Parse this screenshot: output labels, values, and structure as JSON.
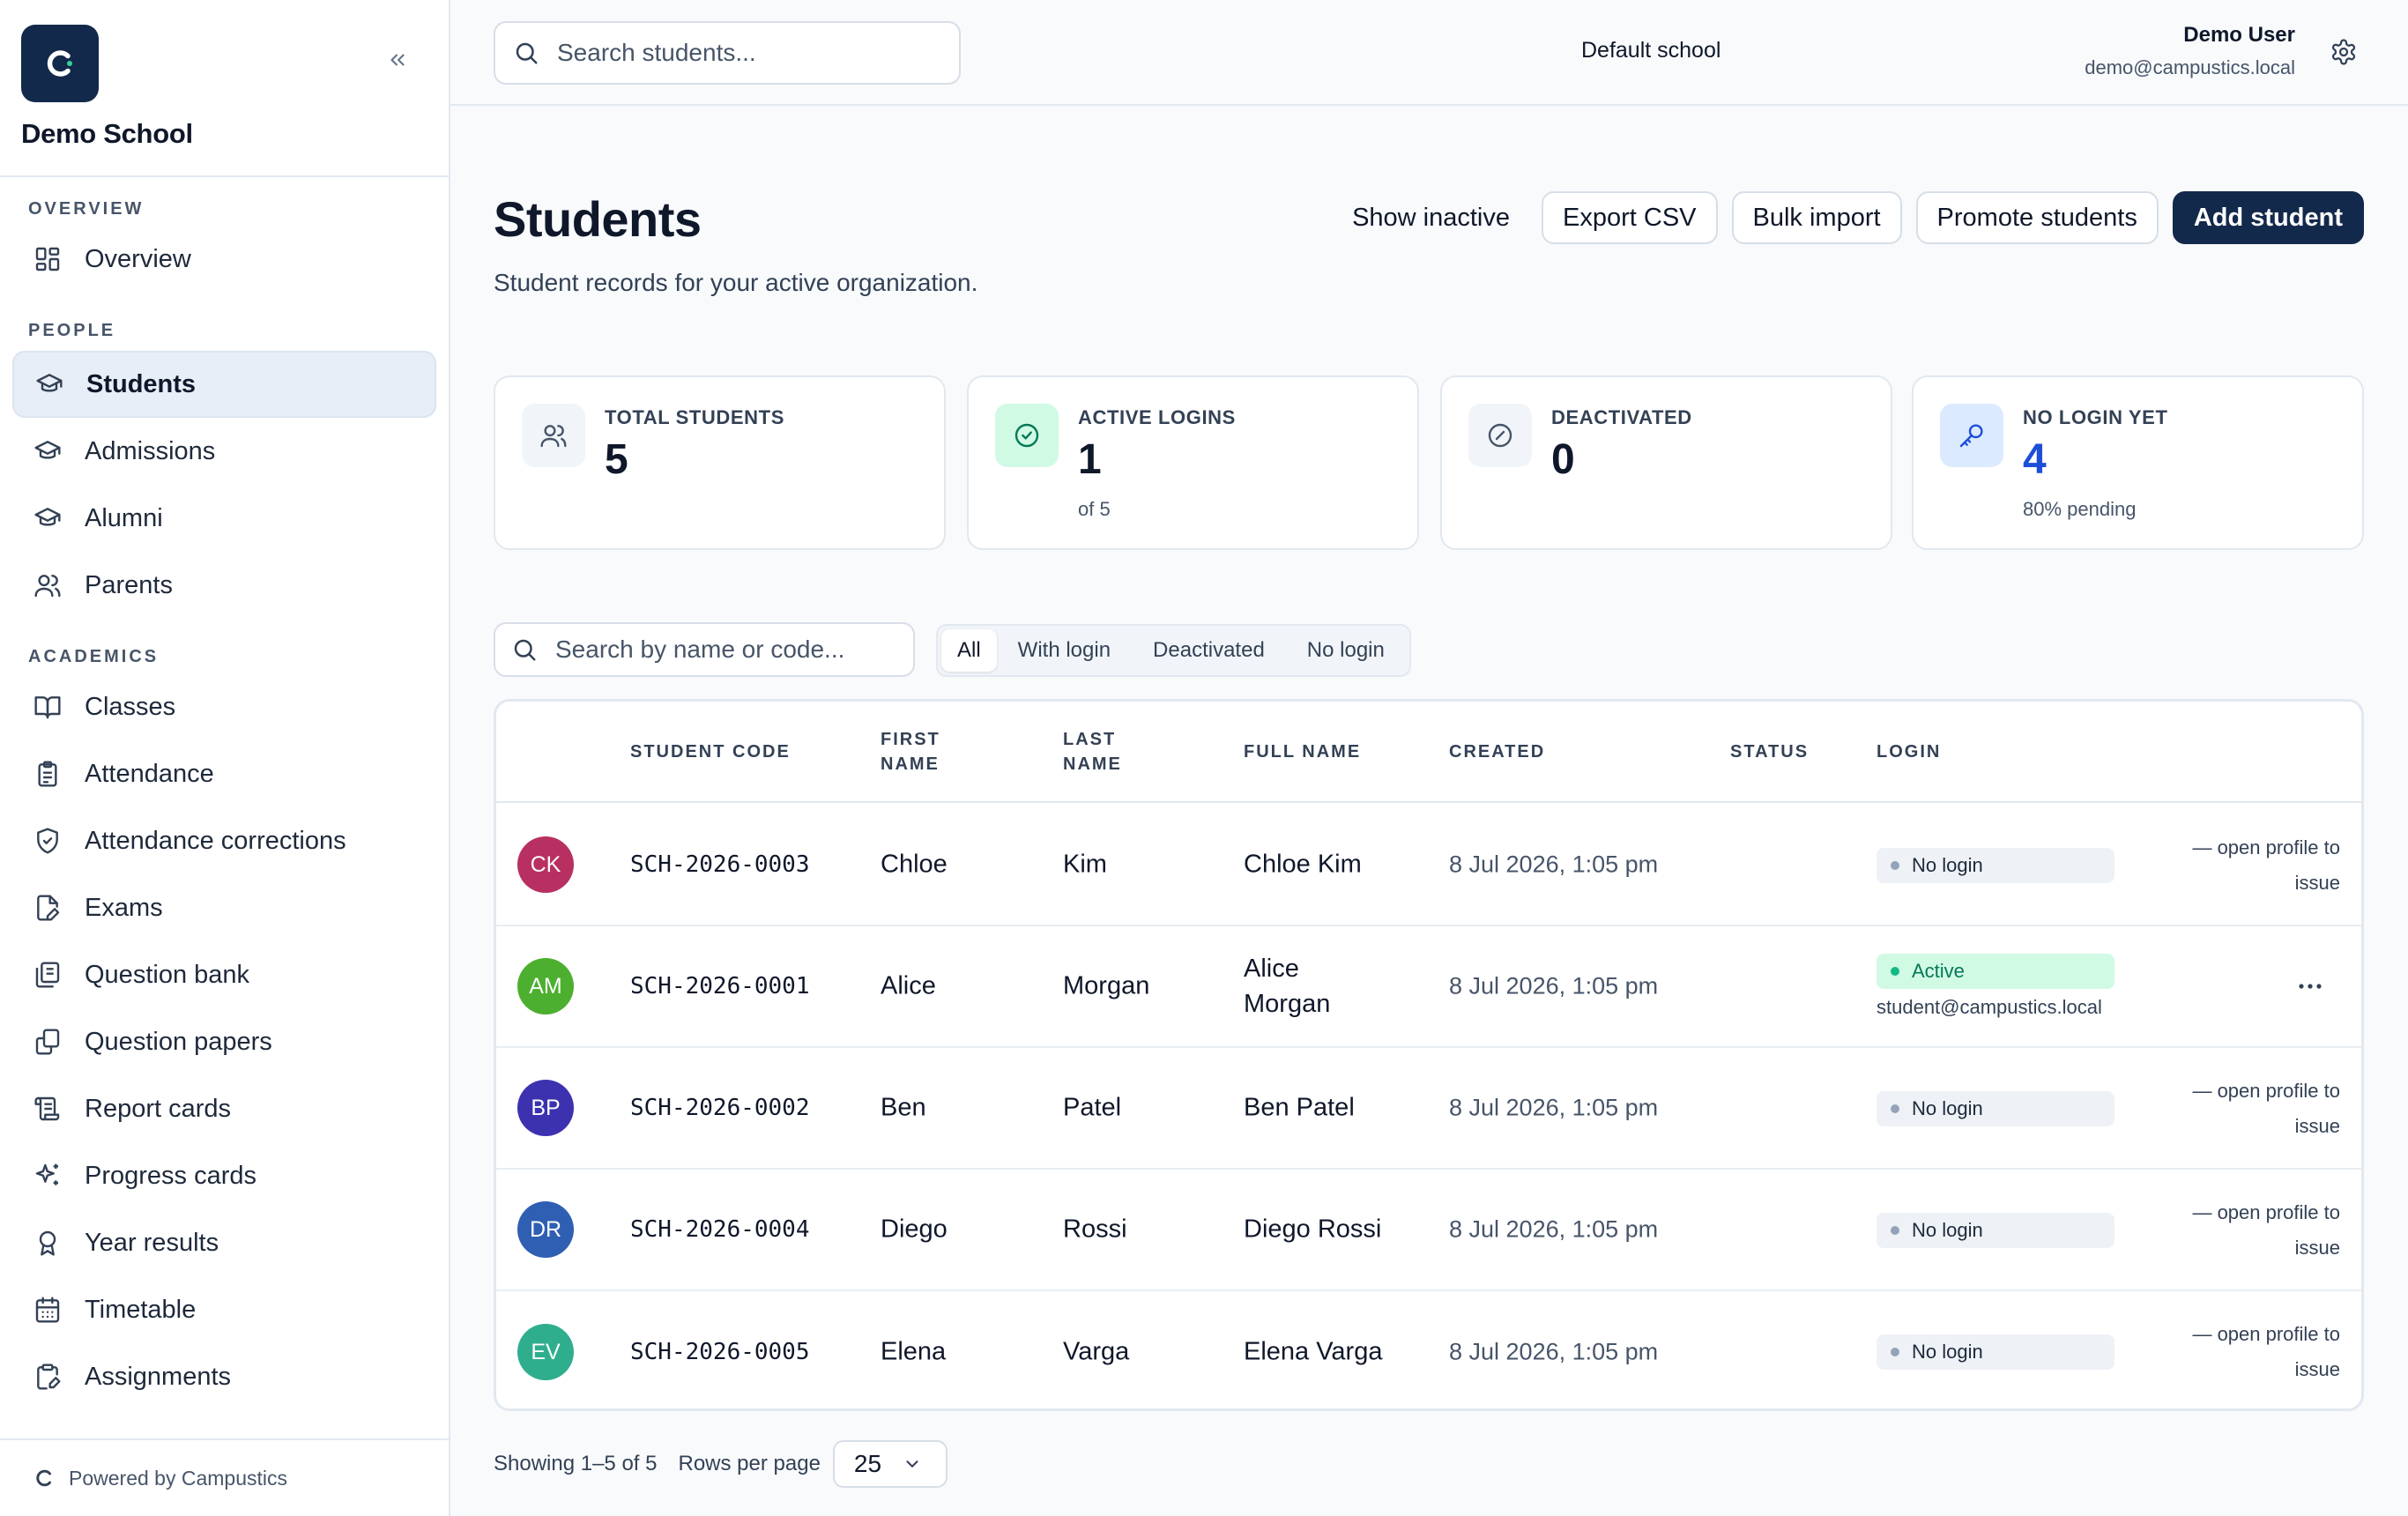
{
  "sidebar": {
    "brand_letter": "C",
    "school_name": "Demo School",
    "sections": [
      {
        "title": "OVERVIEW",
        "items": [
          {
            "label": "Overview",
            "icon": "dashboard-icon"
          }
        ]
      },
      {
        "title": "PEOPLE",
        "items": [
          {
            "label": "Students",
            "icon": "graduation-cap-icon",
            "active": true
          },
          {
            "label": "Admissions",
            "icon": "graduation-cap-icon"
          },
          {
            "label": "Alumni",
            "icon": "graduation-cap-icon"
          },
          {
            "label": "Parents",
            "icon": "users-icon"
          }
        ]
      },
      {
        "title": "ACADEMICS",
        "items": [
          {
            "label": "Classes",
            "icon": "book-open-icon"
          },
          {
            "label": "Attendance",
            "icon": "clipboard-list-icon"
          },
          {
            "label": "Attendance corrections",
            "icon": "shield-check-icon"
          },
          {
            "label": "Exams",
            "icon": "file-pen-icon"
          },
          {
            "label": "Question bank",
            "icon": "library-icon"
          },
          {
            "label": "Question papers",
            "icon": "copy-icon"
          },
          {
            "label": "Report cards",
            "icon": "scroll-icon"
          },
          {
            "label": "Progress cards",
            "icon": "sparkles-icon"
          },
          {
            "label": "Year results",
            "icon": "award-icon"
          },
          {
            "label": "Timetable",
            "icon": "calendar-icon"
          },
          {
            "label": "Assignments",
            "icon": "clipboard-pen-icon"
          }
        ]
      }
    ],
    "powered_by": "Powered by Campustics"
  },
  "topbar": {
    "search_placeholder": "Search students...",
    "school": "Default school",
    "user_name": "Demo User",
    "user_email": "demo@campustics.local"
  },
  "page": {
    "title": "Students",
    "subtitle": "Student records for your active organization.",
    "actions": {
      "show_inactive": "Show inactive",
      "export_csv": "Export CSV",
      "bulk_import": "Bulk import",
      "promote": "Promote students",
      "add": "Add student"
    }
  },
  "stats": [
    {
      "label": "TOTAL STUDENTS",
      "value": "5",
      "sub": "",
      "icon": "users-icon"
    },
    {
      "label": "ACTIVE LOGINS",
      "value": "1",
      "sub": "of 5",
      "icon": "check-circle-icon"
    },
    {
      "label": "DEACTIVATED",
      "value": "0",
      "sub": "",
      "icon": "ban-icon"
    },
    {
      "label": "NO LOGIN YET",
      "value": "4",
      "sub": "80% pending",
      "icon": "key-icon"
    }
  ],
  "filters": {
    "search_placeholder": "Search by name or code...",
    "segments": [
      "All",
      "With login",
      "Deactivated",
      "No login"
    ],
    "active_segment": "All"
  },
  "table": {
    "columns": {
      "code": "STUDENT CODE",
      "first_1": "FIRST",
      "first_2": "NAME",
      "last_1": "LAST",
      "last_2": "NAME",
      "full": "FULL NAME",
      "created": "CREATED",
      "status": "STATUS",
      "login": "LOGIN"
    },
    "rows": [
      {
        "initials": "CK",
        "color": "#b83062",
        "code": "SCH-2026-0003",
        "first": "Chloe",
        "last": "Kim",
        "full_1": "Chloe Kim",
        "full_2": "",
        "created": "8 Jul 2026, 1:05 pm",
        "login": "No login",
        "email": "",
        "note_1": "— open profile to",
        "note_2": "issue"
      },
      {
        "initials": "AM",
        "color": "#4caf2f",
        "code": "SCH-2026-0001",
        "first": "Alice",
        "last": "Morgan",
        "full_1": "Alice",
        "full_2": "Morgan",
        "created": "8 Jul 2026, 1:05 pm",
        "login": "Active",
        "email": "student@campustics.local",
        "note_1": "",
        "note_2": ""
      },
      {
        "initials": "BP",
        "color": "#3c32b0",
        "code": "SCH-2026-0002",
        "first": "Ben",
        "last": "Patel",
        "full_1": "Ben Patel",
        "full_2": "",
        "created": "8 Jul 2026, 1:05 pm",
        "login": "No login",
        "email": "",
        "note_1": "— open profile to",
        "note_2": "issue"
      },
      {
        "initials": "DR",
        "color": "#2f5fb3",
        "code": "SCH-2026-0004",
        "first": "Diego",
        "last": "Rossi",
        "full_1": "Diego Rossi",
        "full_2": "",
        "created": "8 Jul 2026, 1:05 pm",
        "login": "No login",
        "email": "",
        "note_1": "— open profile to",
        "note_2": "issue"
      },
      {
        "initials": "EV",
        "color": "#2fae8e",
        "code": "SCH-2026-0005",
        "first": "Elena",
        "last": "Varga",
        "full_1": "Elena Varga",
        "full_2": "",
        "created": "8 Jul 2026, 1:05 pm",
        "login": "No login",
        "email": "",
        "note_1": "— open profile to",
        "note_2": "issue"
      }
    ]
  },
  "footer": {
    "showing": "Showing 1–5 of 5",
    "rows_per_page_label": "Rows per page",
    "rows_per_page": "25"
  }
}
